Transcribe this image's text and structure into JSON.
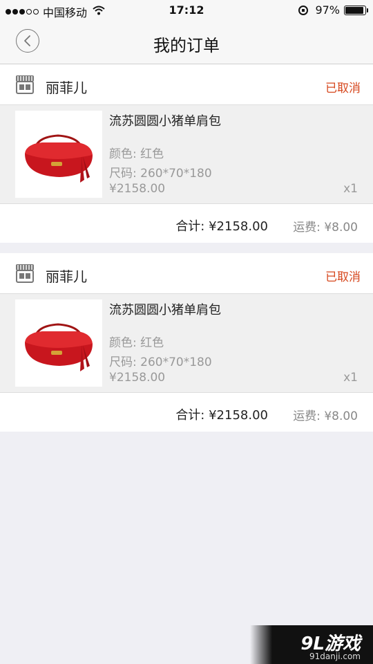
{
  "status_bar": {
    "carrier": "中国移动",
    "time": "17:12",
    "battery": "97%"
  },
  "nav": {
    "title": "我的订单"
  },
  "orders": [
    {
      "shop_name": "丽菲儿",
      "status": "已取消",
      "item": {
        "title": "流苏圆圆小猪单肩包",
        "color": "颜色: 红色",
        "size": "尺码: 260*70*180",
        "price": "¥2158.00",
        "qty": "x1"
      },
      "total": "合计: ¥2158.00",
      "shipping": "运费: ¥8.00"
    },
    {
      "shop_name": "丽菲儿",
      "status": "已取消",
      "item": {
        "title": "流苏圆圆小猪单肩包",
        "color": "颜色: 红色",
        "size": "尺码: 260*70*180",
        "price": "¥2158.00",
        "qty": "x1"
      },
      "total": "合计: ¥2158.00",
      "shipping": "运费: ¥8.00"
    }
  ],
  "watermark": {
    "logo": "9L游戏",
    "url": "91danji.com"
  },
  "colors": {
    "accent": "#d6471d",
    "background": "#efeff4"
  }
}
